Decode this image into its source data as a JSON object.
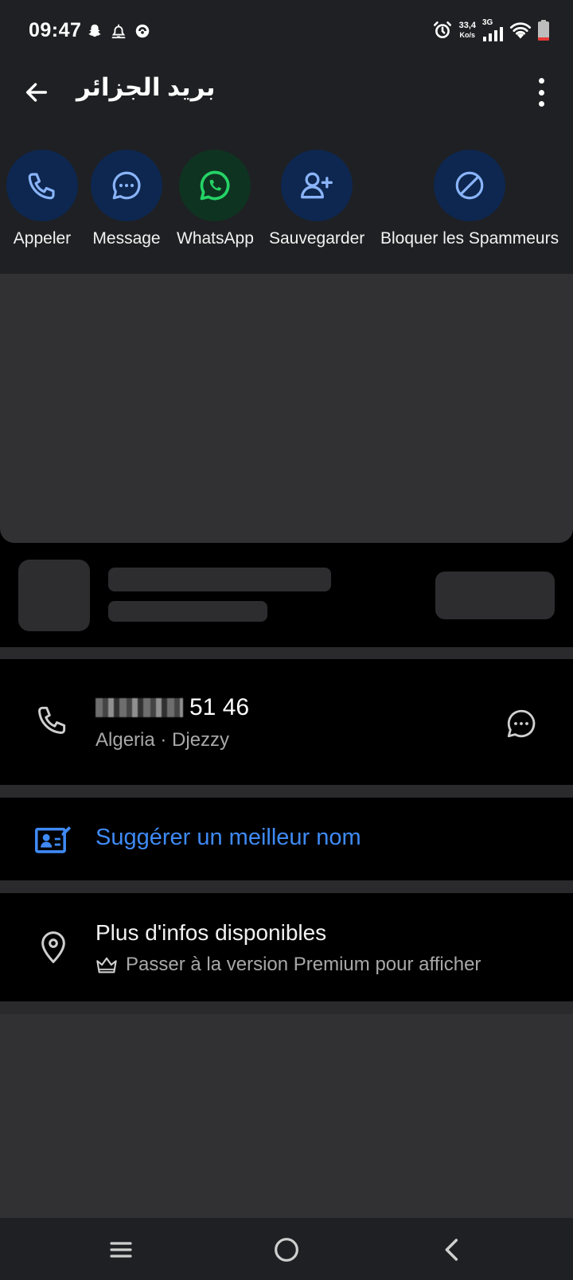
{
  "status_bar": {
    "time": "09:47",
    "net_speed_value": "33,4",
    "net_speed_unit": "Ko/s",
    "network_type": "3G",
    "icons": [
      "snapchat-icon",
      "alarm-bell-icon",
      "app-notification-icon",
      "alarm-clock-icon",
      "signal-icon",
      "wifi-icon",
      "battery-low-icon"
    ]
  },
  "header": {
    "title": "بريد الجزائر",
    "back_icon": "arrow-left-icon",
    "menu_icon": "more-vert-icon"
  },
  "actions": [
    {
      "label": "Appeler",
      "icon": "phone-icon"
    },
    {
      "label": "Message",
      "icon": "chat-bubble-icon"
    },
    {
      "label": "WhatsApp",
      "icon": "whatsapp-icon"
    },
    {
      "label": "Sauvegarder",
      "icon": "person-add-icon"
    },
    {
      "label": "Bloquer les Spammeurs",
      "icon": "block-icon"
    }
  ],
  "phone": {
    "number_visible": "51 46",
    "carrier": "Algeria · Djezzy"
  },
  "suggest": {
    "label": "Suggérer un meilleur nom"
  },
  "info": {
    "title": "Plus d'infos disponibles",
    "subtitle": "Passer à la version Premium pour afficher"
  },
  "nav": {
    "items": [
      "recents-menu-icon",
      "home-icon",
      "back-chevron-icon"
    ]
  },
  "colors": {
    "accent_blue": "#3f8af5",
    "action_circle": "#0d2750",
    "whatsapp_green": "#25d366",
    "battery_red": "#e53935"
  }
}
